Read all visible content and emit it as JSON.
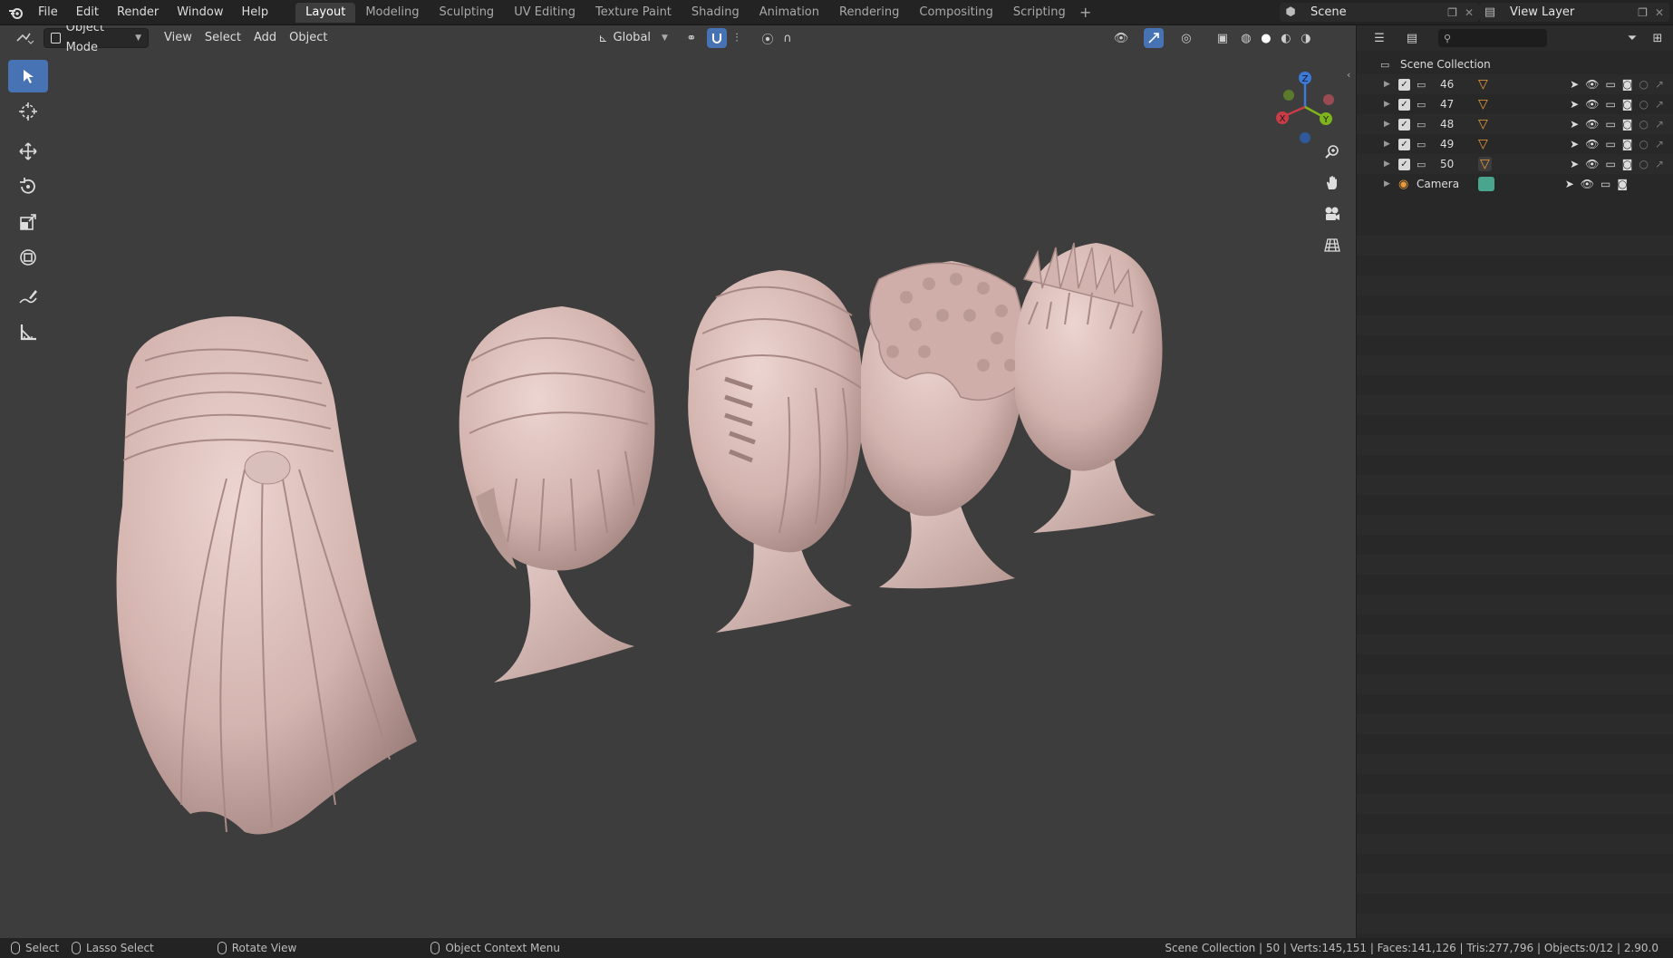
{
  "menu": [
    "File",
    "Edit",
    "Render",
    "Window",
    "Help"
  ],
  "workspaces": [
    "Layout",
    "Modeling",
    "Sculpting",
    "UV Editing",
    "Texture Paint",
    "Shading",
    "Animation",
    "Rendering",
    "Compositing",
    "Scripting"
  ],
  "active_workspace": "Layout",
  "scene_name": "Scene",
  "view_layer": "View Layer",
  "viewport": {
    "mode": "Object Mode",
    "menus": [
      "View",
      "Select",
      "Add",
      "Object"
    ],
    "transform_orientation": "Global"
  },
  "gizmo": {
    "x": "X",
    "y": "Y",
    "z": "Z"
  },
  "outliner": {
    "root": "Scene Collection",
    "items": [
      {
        "label": "46",
        "type": "collection"
      },
      {
        "label": "47",
        "type": "collection"
      },
      {
        "label": "48",
        "type": "collection"
      },
      {
        "label": "49",
        "type": "collection"
      },
      {
        "label": "50",
        "type": "collection"
      },
      {
        "label": "Camera",
        "type": "camera"
      }
    ]
  },
  "status": {
    "select": "Select",
    "lasso": "Lasso Select",
    "rotate": "Rotate View",
    "context": "Object Context Menu",
    "info": "Scene Collection | 50 | Verts:145,151 | Faces:141,126 | Tris:277,796 | Objects:0/12 | 2.90.0"
  },
  "colors": {
    "accent": "#4772b3",
    "viewport_bg": "#3d3d3d",
    "head": "#d9bfbb",
    "collection_icon": "#e89a3c",
    "camera_icon": "#4aa58f"
  }
}
